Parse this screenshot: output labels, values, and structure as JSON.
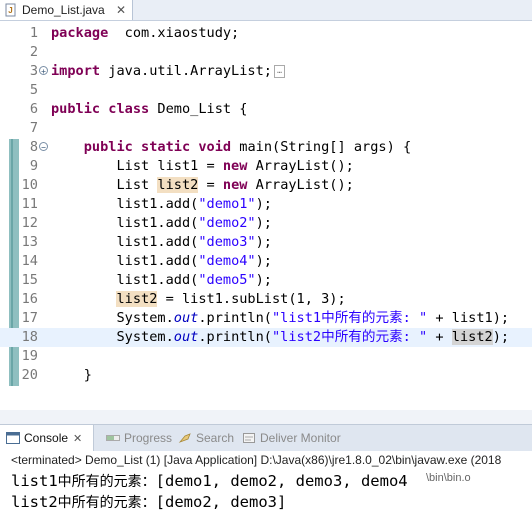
{
  "editor_tab": {
    "title": "Demo_List.java",
    "close": "✕"
  },
  "code_lines": [
    {
      "num": "1",
      "parts": [
        [
          "kw",
          "package"
        ],
        [
          "",
          "  com.xiaostudy;"
        ]
      ]
    },
    {
      "num": "2",
      "parts": []
    },
    {
      "num": "3",
      "fold": "plus",
      "folded": true,
      "parts": [
        [
          "kw",
          "import"
        ],
        [
          "",
          " java.util.ArrayList;"
        ]
      ]
    },
    {
      "num": "5",
      "parts": []
    },
    {
      "num": "6",
      "parts": [
        [
          "kw",
          "public"
        ],
        [
          "",
          " "
        ],
        [
          "kw",
          "class"
        ],
        [
          "",
          " Demo_List {"
        ]
      ]
    },
    {
      "num": "7",
      "parts": []
    },
    {
      "num": "8",
      "fold": "minus",
      "parts": [
        [
          "",
          "    "
        ],
        [
          "kw",
          "public"
        ],
        [
          "",
          " "
        ],
        [
          "kw",
          "static"
        ],
        [
          "",
          " "
        ],
        [
          "kw",
          "void"
        ],
        [
          "",
          " main(String[] args) {"
        ]
      ]
    },
    {
      "num": "9",
      "parts": [
        [
          "",
          "        List list1 = "
        ],
        [
          "kw",
          "new"
        ],
        [
          "",
          " ArrayList();"
        ]
      ]
    },
    {
      "num": "10",
      "parts": [
        [
          "",
          "        List "
        ],
        [
          "hl",
          "list2"
        ],
        [
          "",
          " = "
        ],
        [
          "kw",
          "new"
        ],
        [
          "",
          " ArrayList();"
        ]
      ]
    },
    {
      "num": "11",
      "parts": [
        [
          "",
          "        list1.add("
        ],
        [
          "str",
          "\"demo1\""
        ],
        [
          "",
          ");"
        ]
      ]
    },
    {
      "num": "12",
      "parts": [
        [
          "",
          "        list1.add("
        ],
        [
          "str",
          "\"demo2\""
        ],
        [
          "",
          ");"
        ]
      ]
    },
    {
      "num": "13",
      "parts": [
        [
          "",
          "        list1.add("
        ],
        [
          "str",
          "\"demo3\""
        ],
        [
          "",
          ");"
        ]
      ]
    },
    {
      "num": "14",
      "parts": [
        [
          "",
          "        list1.add("
        ],
        [
          "str",
          "\"demo4\""
        ],
        [
          "",
          ");"
        ]
      ]
    },
    {
      "num": "15",
      "parts": [
        [
          "",
          "        list1.add("
        ],
        [
          "str",
          "\"demo5\""
        ],
        [
          "",
          ");"
        ]
      ]
    },
    {
      "num": "16",
      "parts": [
        [
          "",
          "        "
        ],
        [
          "hl",
          "list2"
        ],
        [
          "",
          " = list1.subList(1, 3);"
        ]
      ]
    },
    {
      "num": "17",
      "parts": [
        [
          "",
          "        System."
        ],
        [
          "field",
          "out"
        ],
        [
          "",
          ".println("
        ],
        [
          "str",
          "\"list1中所有的元素: \""
        ],
        [
          "",
          " + list1);"
        ]
      ]
    },
    {
      "num": "18",
      "current": true,
      "parts": [
        [
          "",
          "        System."
        ],
        [
          "field",
          "out"
        ],
        [
          "",
          ".println("
        ],
        [
          "str",
          "\"list2中所有的元素: \""
        ],
        [
          "",
          " + "
        ],
        [
          "hl2",
          "list2"
        ],
        [
          "",
          ");"
        ]
      ]
    },
    {
      "num": "19",
      "parts": []
    },
    {
      "num": "20",
      "parts": [
        [
          "",
          "    }"
        ]
      ]
    }
  ],
  "console_tabs": [
    {
      "label": "Console",
      "icon": "console-icon",
      "active": true,
      "close": "✕"
    },
    {
      "label": "Progress",
      "icon": "progress-icon",
      "active": false
    },
    {
      "label": "Search",
      "icon": "search-icon",
      "active": false
    },
    {
      "label": "Deliver Monitor",
      "icon": "deliver-monitor-icon",
      "active": false
    }
  ],
  "console": {
    "terminated_line": "<terminated> Demo_List (1) [Java Application] D:\\Java(x86)\\jre1.8.0_02\\bin\\javaw.exe (2018",
    "output": [
      {
        "prefix": "list1",
        "cjk": "中所有的元素：",
        "rest": "[demo1, demo2, demo3, demo4"
      },
      {
        "prefix": "list2",
        "cjk": "中所有的元素：",
        "rest": "[demo2, demo3]"
      }
    ],
    "overlay": "\\bin\\bin.o"
  },
  "colors": {
    "keyword": "#7f0055",
    "string": "#2a00ff",
    "field": "#0000c0",
    "occurrence": "#f3dfc2",
    "current_line": "#e8f2fe"
  }
}
